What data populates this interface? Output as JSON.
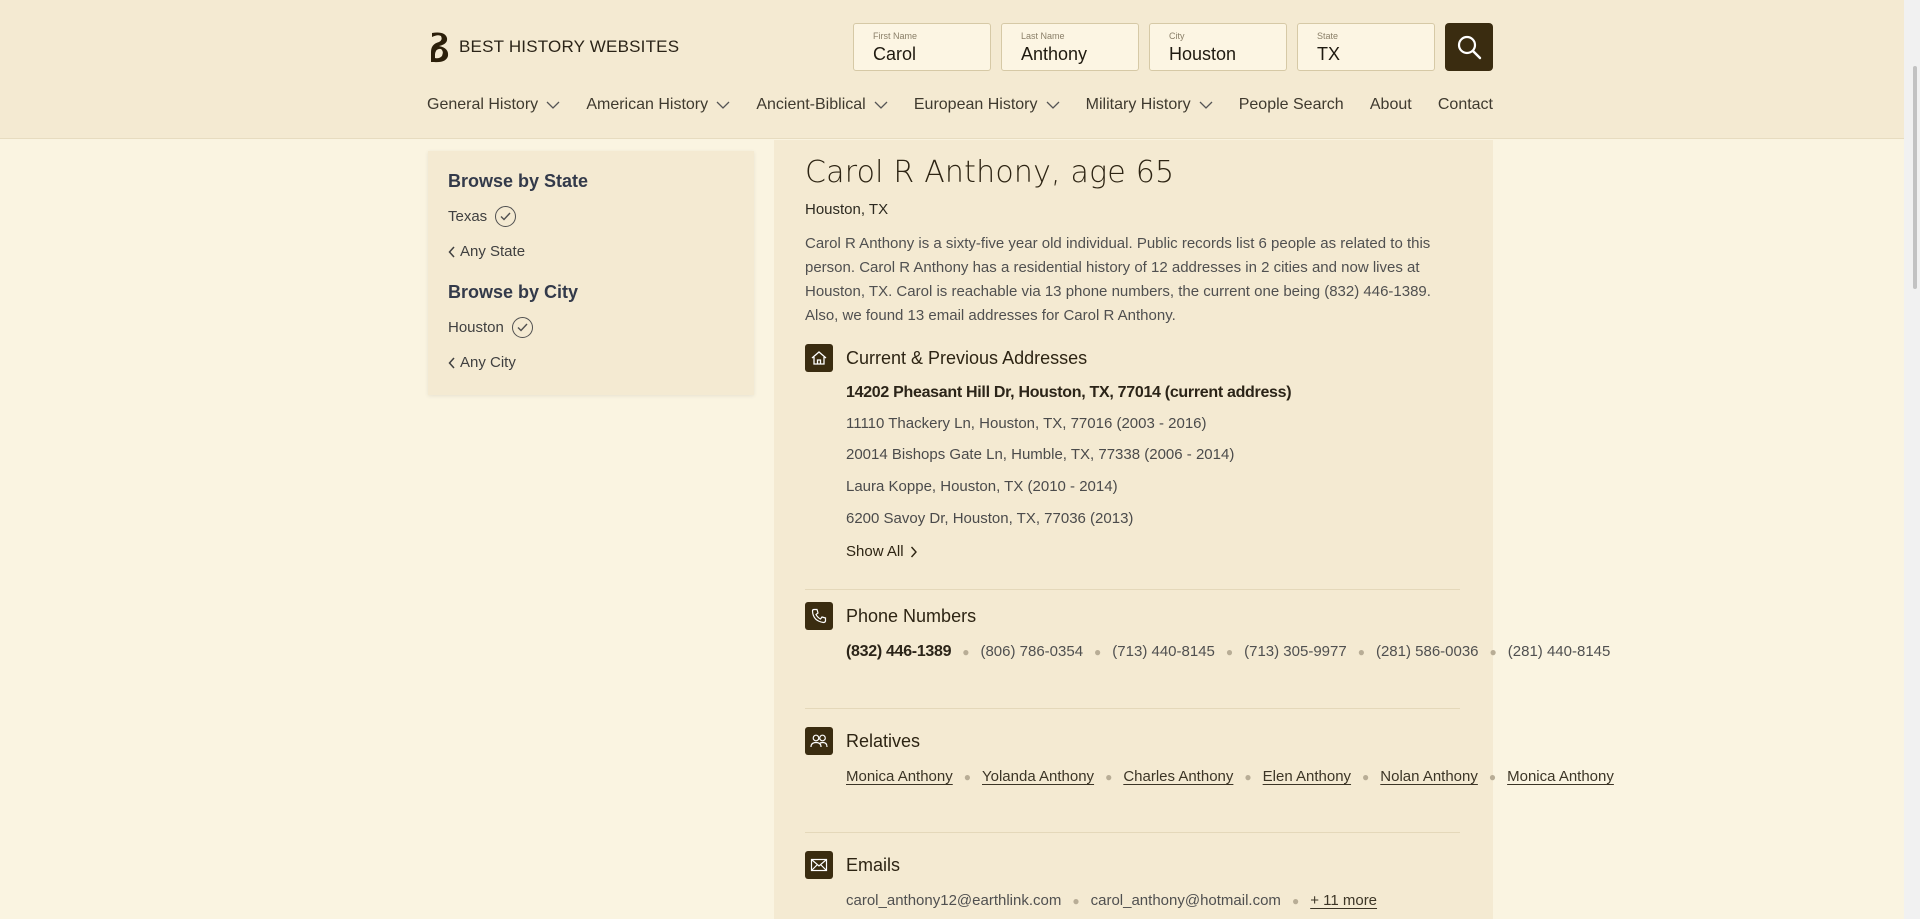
{
  "brand": {
    "name": "BEST HISTORY WEBSITES"
  },
  "search": {
    "first_name": {
      "label": "First Name",
      "value": "Carol"
    },
    "last_name": {
      "label": "Last Name",
      "value": "Anthony"
    },
    "city": {
      "label": "City",
      "value": "Houston"
    },
    "state": {
      "label": "State",
      "value": "TX"
    }
  },
  "nav": {
    "general": "General History",
    "american": "American History",
    "ancient": "Ancient-Biblical",
    "european": "European History",
    "military": "Military History",
    "people": "People Search",
    "about": "About",
    "contact": "Contact"
  },
  "sidebar": {
    "state_heading": "Browse by State",
    "state_selected": "Texas",
    "any_state": "Any State",
    "city_heading": "Browse by City",
    "city_selected": "Houston",
    "any_city": "Any City"
  },
  "person": {
    "title": "Carol R Anthony, age 65",
    "location": "Houston, TX",
    "description": "Carol R Anthony is a sixty-five year old individual. Public records list 6 people as related to this person. Carol R Anthony has a residential history of 12 addresses in 2 cities and now lives at Houston, TX. Carol is reachable via 13 phone numbers, the current one being (832) 446-1389. Also, we found 13 email addresses for Carol R Anthony."
  },
  "addresses": {
    "title": "Current & Previous Addresses",
    "current": "14202 Pheasant Hill Dr, Houston, TX, 77014 (current address)",
    "items": [
      "11110 Thackery Ln, Houston, TX, 77016 (2003 - 2016)",
      "20014 Bishops Gate Ln, Humble, TX, 77338 (2006 - 2014)",
      "Laura Koppe, Houston, TX (2010 - 2014)",
      "6200 Savoy Dr, Houston, TX, 77036 (2013)"
    ],
    "show_all": "Show All"
  },
  "phones": {
    "title": "Phone Numbers",
    "items": [
      "(832) 446-1389",
      "(806) 786-0354",
      "(713) 440-8145",
      "(713) 305-9977",
      "(281) 586-0036",
      "(281) 440-8145"
    ]
  },
  "relatives": {
    "title": "Relatives",
    "items": [
      "Monica Anthony",
      "Yolanda Anthony",
      "Charles Anthony",
      "Elen Anthony",
      "Nolan Anthony",
      "Monica Anthony"
    ]
  },
  "emails": {
    "title": "Emails",
    "items": [
      "carol_anthony12@earthlink.com",
      "carol_anthony@hotmail.com"
    ],
    "more": "+ 11 more"
  },
  "colors": {
    "accent": "#3a2c10",
    "header_bg": "#f4ead2",
    "page_bg": "#faf4e1"
  }
}
